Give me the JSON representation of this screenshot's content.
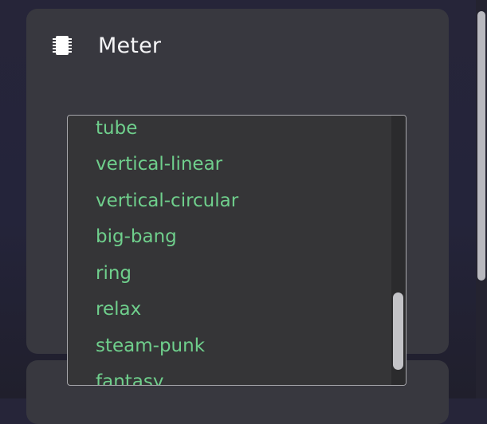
{
  "card": {
    "title": "Meter",
    "icon": "chip-icon"
  },
  "dropdown": {
    "options": [
      "tube",
      "vertical-linear",
      "vertical-circular",
      "big-bang",
      "ring",
      "relax",
      "steam-punk",
      "fantasy"
    ]
  },
  "colors": {
    "option_text": "#6fcf8c",
    "card_background": "#38383f",
    "list_background": "#353537"
  }
}
